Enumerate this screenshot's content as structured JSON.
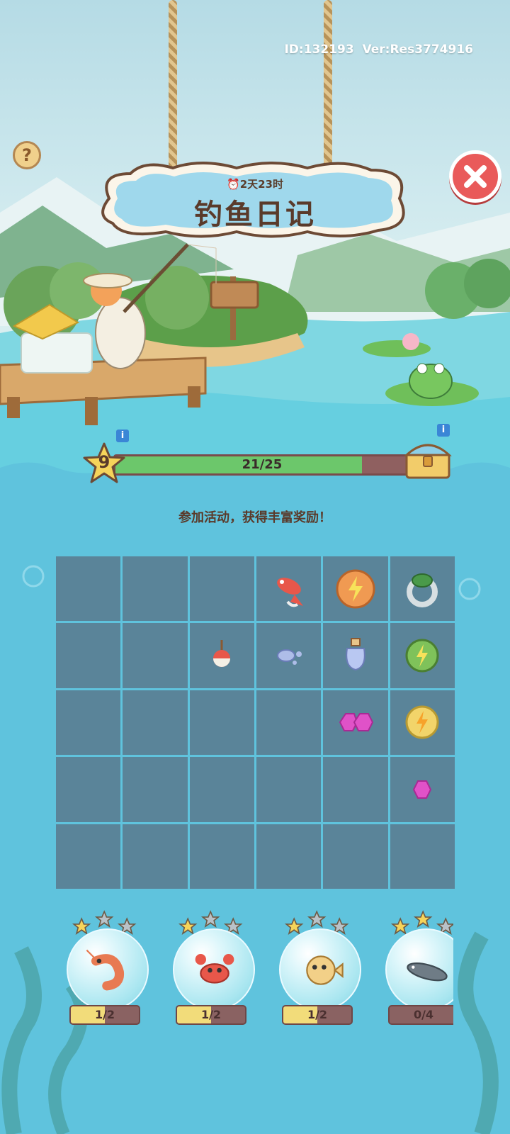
{
  "header": {
    "id_text": "ID:132193  Ver:Res3774916",
    "help_label": "?",
    "timer": "2天23时",
    "title": "钓鱼日记"
  },
  "progress": {
    "level": "9",
    "label": "21/25",
    "current": 21,
    "max": 25,
    "info_label": "i"
  },
  "promo_text": "参加活动，获得丰富奖励！",
  "grid": {
    "rows": 5,
    "cols": 6,
    "items": [
      {
        "row": 0,
        "col": 3,
        "icon": "koi-fish-icon"
      },
      {
        "row": 0,
        "col": 4,
        "icon": "orange-energy-coin-icon"
      },
      {
        "row": 0,
        "col": 5,
        "icon": "turtle-ring-icon"
      },
      {
        "row": 1,
        "col": 2,
        "icon": "fishing-float-icon"
      },
      {
        "row": 1,
        "col": 3,
        "icon": "stones-icon"
      },
      {
        "row": 1,
        "col": 4,
        "icon": "potion-bottle-icon"
      },
      {
        "row": 1,
        "col": 5,
        "icon": "green-energy-coin-icon"
      },
      {
        "row": 2,
        "col": 4,
        "icon": "pink-gems-icon"
      },
      {
        "row": 2,
        "col": 5,
        "icon": "yellow-energy-coin-icon"
      },
      {
        "row": 3,
        "col": 5,
        "icon": "pink-gem-icon"
      }
    ]
  },
  "fish_cards": [
    {
      "icon": "shrimp-icon",
      "label": "1/2",
      "progress": 0.5,
      "stars_lit": 1
    },
    {
      "icon": "crab-icon",
      "label": "1/2",
      "progress": 0.5,
      "stars_lit": 1
    },
    {
      "icon": "pufferfish-icon",
      "label": "1/2",
      "progress": 0.5,
      "stars_lit": 1
    },
    {
      "icon": "catfish-icon",
      "label": "0/4",
      "progress": 0,
      "stars_lit": 2
    }
  ],
  "colors": {
    "panel_blue": "#5fc3dd",
    "grid_cell": "#5a8499",
    "progress_green": "#6cc76b",
    "close_red": "#e95a5a"
  }
}
